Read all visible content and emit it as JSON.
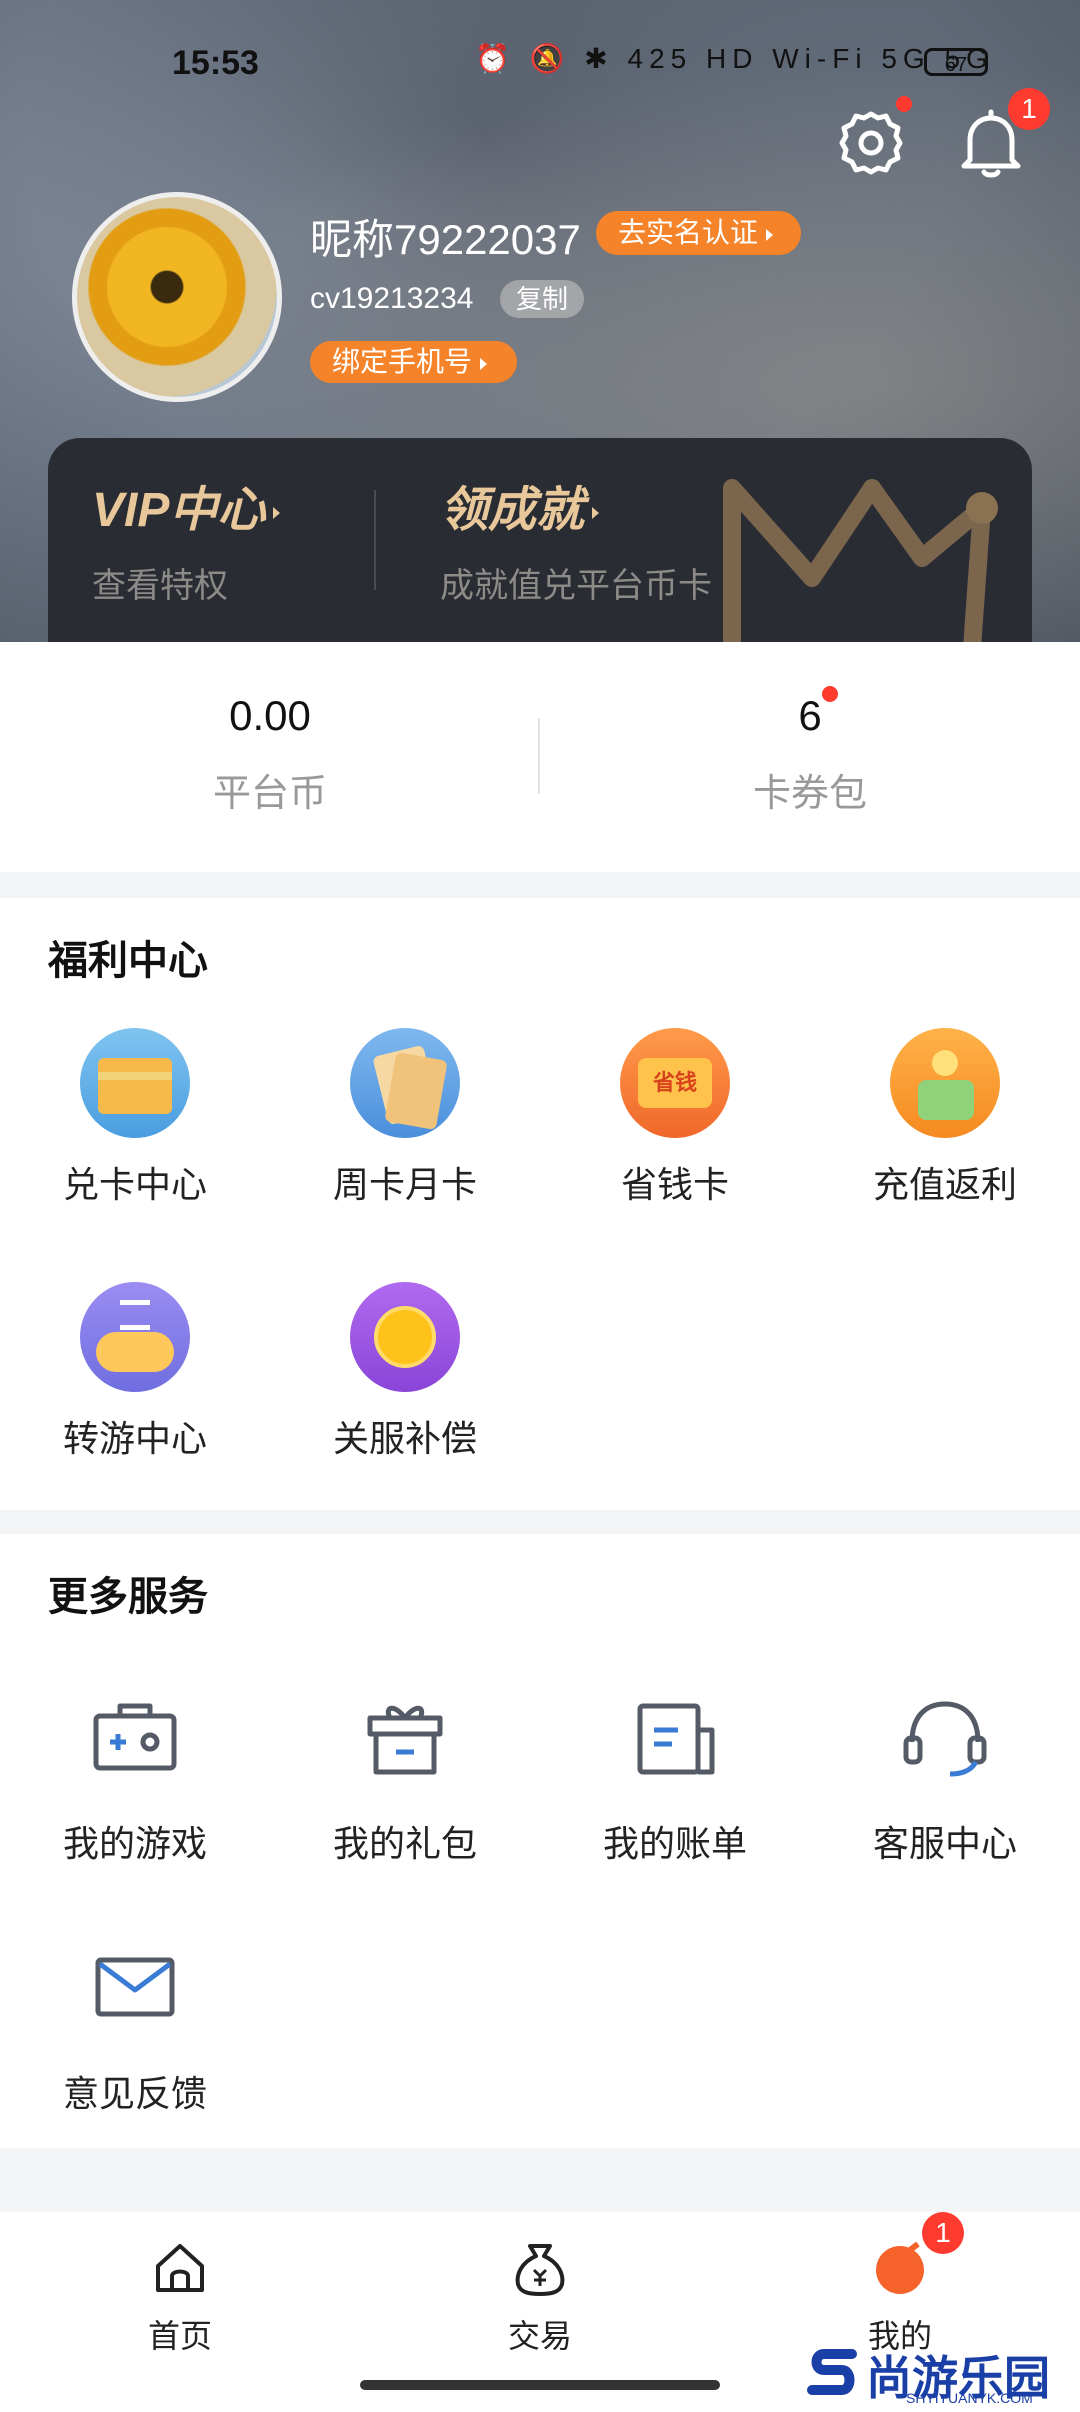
{
  "status_bar": {
    "time": "15:53",
    "icons": "⏰ 🔕 ✱ 425 HD Wi-Fi 5G 5G",
    "battery": "67"
  },
  "header": {
    "notification_count": "1"
  },
  "profile": {
    "nickname": "昵称79222037",
    "verify_label": "去实名认证",
    "uid": "cv19213234",
    "copy_label": "复制",
    "bind_phone_label": "绑定手机号"
  },
  "vip_card": {
    "vip_title": "VIP中心",
    "vip_sub": "查看特权",
    "achieve_title": "领成就",
    "achieve_sub": "成就值兑平台币卡"
  },
  "wallet": {
    "coins_value": "0.00",
    "coins_label": "平台币",
    "coupons_value": "6",
    "coupons_label": "卡券包"
  },
  "welfare": {
    "title": "福利中心",
    "items": [
      {
        "label": "兑卡中心",
        "icon": "card-exchange-icon"
      },
      {
        "label": "周卡月卡",
        "icon": "vip-card-icon"
      },
      {
        "label": "省钱卡",
        "icon": "save-money-card-icon"
      },
      {
        "label": "充值返利",
        "icon": "recharge-rebate-icon"
      },
      {
        "label": "转游中心",
        "icon": "game-transfer-icon"
      },
      {
        "label": "关服补偿",
        "icon": "compensation-coin-icon"
      }
    ],
    "save_card_text": "省钱"
  },
  "services": {
    "title": "更多服务",
    "items": [
      {
        "label": "我的游戏",
        "icon": "game-controller-icon"
      },
      {
        "label": "我的礼包",
        "icon": "gift-icon"
      },
      {
        "label": "我的账单",
        "icon": "bill-icon"
      },
      {
        "label": "客服中心",
        "icon": "headset-icon"
      },
      {
        "label": "意见反馈",
        "icon": "mail-icon"
      }
    ]
  },
  "tabbar": {
    "items": [
      {
        "label": "首页",
        "icon": "home-icon"
      },
      {
        "label": "交易",
        "icon": "money-bag-icon"
      },
      {
        "label": "我的",
        "icon": "profile-icon"
      }
    ],
    "badge": "1"
  },
  "watermark": {
    "text": "尚游乐园",
    "sub": "SHYIYUANYK.COM"
  },
  "colors": {
    "accent": "#f5832a",
    "badge": "#ff3b30",
    "vip_gold": "#e8c89a",
    "icon_blue": "#3a7bd5"
  }
}
